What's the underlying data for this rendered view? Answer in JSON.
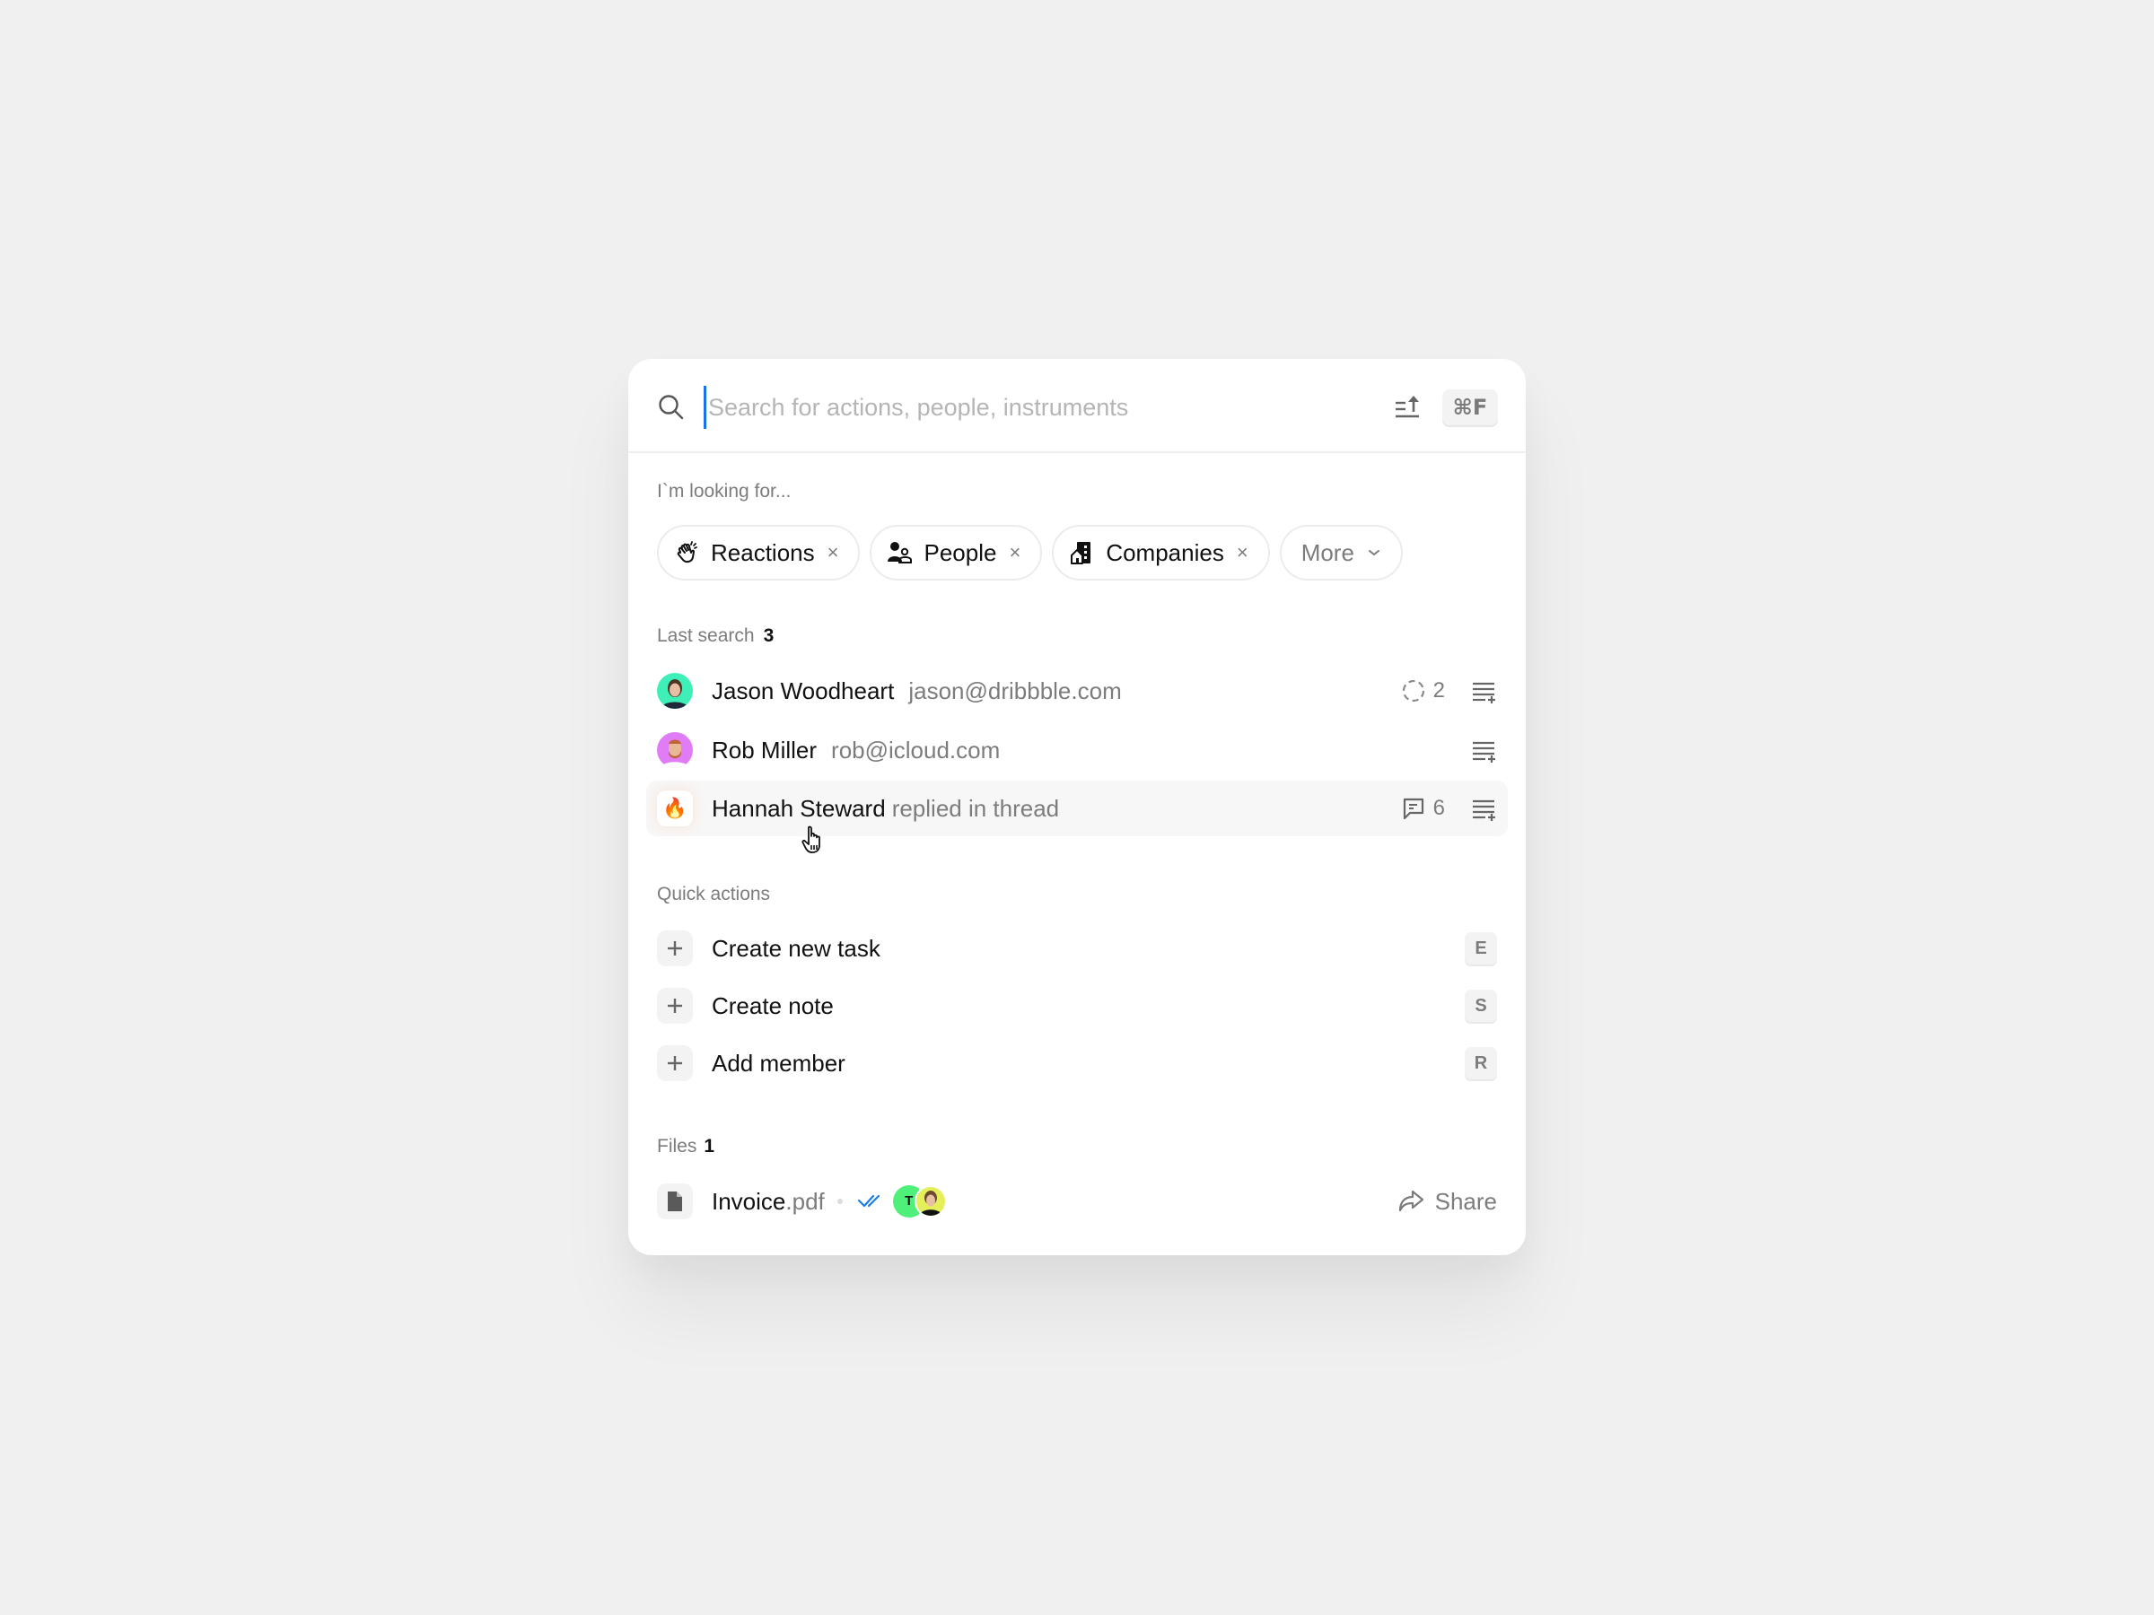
{
  "search": {
    "placeholder": "Search for actions, people, instruments",
    "value": "",
    "shortcut": "⌘F",
    "icons": {
      "search": "search-icon",
      "sort": "sort-ascending-icon"
    }
  },
  "filters": {
    "label": "I`m looking for...",
    "chips": [
      {
        "label": "Reactions",
        "icon": "clapping-hands-icon",
        "removable": true
      },
      {
        "label": "People",
        "icon": "people-icon",
        "removable": true
      },
      {
        "label": "Companies",
        "icon": "building-icon",
        "removable": true
      }
    ],
    "more": {
      "label": "More",
      "icon": "chevron-down-icon"
    },
    "remove_glyph": "×"
  },
  "last_search": {
    "label": "Last search",
    "count": "3",
    "items": [
      {
        "name": "Jason Woodheart",
        "detail": "jason@dribbble.com",
        "avatar_color": "#3ef0b8",
        "meta_icon": "dashed-circle-icon",
        "meta_value": "2",
        "action_icon": "add-to-list-icon"
      },
      {
        "name": "Rob Miller",
        "detail": "rob@icloud.com",
        "avatar_color": "#e07cf5",
        "action_icon": "add-to-list-icon"
      },
      {
        "name": "Hannah Steward",
        "detail": "replied in thread",
        "lead_emoji": "🔥",
        "meta_icon": "comment-icon",
        "meta_value": "6",
        "action_icon": "add-to-list-icon",
        "hovered": true
      }
    ]
  },
  "quick_actions": {
    "label": "Quick actions",
    "items": [
      {
        "label": "Create new task",
        "shortcut": "E",
        "icon": "plus-icon"
      },
      {
        "label": "Create note",
        "shortcut": "S",
        "icon": "plus-icon"
      },
      {
        "label": "Add member",
        "shortcut": "R",
        "icon": "plus-icon"
      }
    ]
  },
  "files": {
    "label": "Files",
    "count": "1",
    "items": [
      {
        "name": "Invoice",
        "ext": ".pdf",
        "status_icon": "double-check-icon",
        "status_color": "#1a7ee8",
        "avatars": [
          {
            "initial": "T",
            "color": "#4ef07a"
          },
          {
            "color": "#e5ef5a"
          }
        ],
        "action": "Share"
      }
    ]
  },
  "colors": {
    "background": "#f0f0f0",
    "card": "#ffffff",
    "accent": "#1a73e8",
    "muted_text": "#7c7c7c",
    "highlight": "#f7f7f7"
  }
}
